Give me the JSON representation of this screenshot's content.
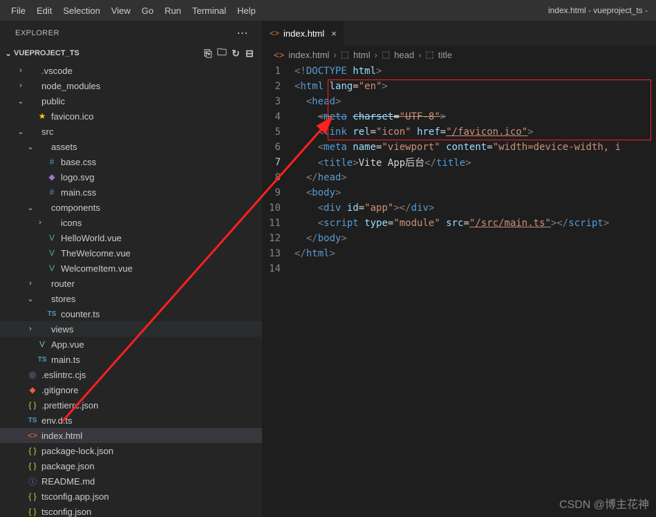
{
  "menu": {
    "items": [
      "File",
      "Edit",
      "Selection",
      "View",
      "Go",
      "Run",
      "Terminal",
      "Help"
    ],
    "title": "index.html - vueproject_ts -"
  },
  "explorer": {
    "title": "EXPLORER",
    "project": "VUEPROJECT_TS"
  },
  "tree": [
    {
      "ind": 1,
      "chev": "›",
      "ico": "",
      "lbl": ".vscode",
      "t": "d"
    },
    {
      "ind": 1,
      "chev": "›",
      "ico": "",
      "lbl": "node_modules",
      "t": "d"
    },
    {
      "ind": 1,
      "chev": "⌄",
      "ico": "",
      "lbl": "public",
      "t": "d"
    },
    {
      "ind": 2,
      "chev": "",
      "ico": "★",
      "cls": "star",
      "lbl": "favicon.ico",
      "t": "f"
    },
    {
      "ind": 1,
      "chev": "⌄",
      "ico": "",
      "lbl": "src",
      "t": "d"
    },
    {
      "ind": 2,
      "chev": "⌄",
      "ico": "",
      "lbl": "assets",
      "t": "d"
    },
    {
      "ind": 3,
      "chev": "",
      "ico": "#",
      "cls": "css",
      "lbl": "base.css",
      "t": "f"
    },
    {
      "ind": 3,
      "chev": "",
      "ico": "◆",
      "cls": "svg",
      "lbl": "logo.svg",
      "t": "f"
    },
    {
      "ind": 3,
      "chev": "",
      "ico": "#",
      "cls": "css",
      "lbl": "main.css",
      "t": "f"
    },
    {
      "ind": 2,
      "chev": "⌄",
      "ico": "",
      "lbl": "components",
      "t": "d"
    },
    {
      "ind": 3,
      "chev": "›",
      "ico": "",
      "lbl": "icons",
      "t": "d"
    },
    {
      "ind": 3,
      "chev": "",
      "ico": "V",
      "cls": "vue",
      "lbl": "HelloWorld.vue",
      "t": "f"
    },
    {
      "ind": 3,
      "chev": "",
      "ico": "V",
      "cls": "vue",
      "lbl": "TheWelcome.vue",
      "t": "f"
    },
    {
      "ind": 3,
      "chev": "",
      "ico": "V",
      "cls": "vue",
      "lbl": "WelcomeItem.vue",
      "t": "f"
    },
    {
      "ind": 2,
      "chev": "›",
      "ico": "",
      "lbl": "router",
      "t": "d"
    },
    {
      "ind": 2,
      "chev": "⌄",
      "ico": "",
      "lbl": "stores",
      "t": "d"
    },
    {
      "ind": 3,
      "chev": "",
      "ico": "TS",
      "cls": "ts",
      "lbl": "counter.ts",
      "t": "f"
    },
    {
      "ind": 2,
      "chev": "›",
      "ico": "",
      "lbl": "views",
      "t": "d",
      "sel": "views"
    },
    {
      "ind": 2,
      "chev": "",
      "ico": "V",
      "cls": "vue-s",
      "lbl": "App.vue",
      "t": "f"
    },
    {
      "ind": 2,
      "chev": "",
      "ico": "TS",
      "cls": "ts",
      "lbl": "main.ts",
      "t": "f"
    },
    {
      "ind": 1,
      "chev": "",
      "ico": "◎",
      "cls": "target",
      "lbl": ".eslintrc.cjs",
      "t": "f"
    },
    {
      "ind": 1,
      "chev": "",
      "ico": "◆",
      "cls": "git",
      "lbl": ".gitignore",
      "t": "f"
    },
    {
      "ind": 1,
      "chev": "",
      "ico": "{ }",
      "cls": "json",
      "lbl": ".prettierrc.json",
      "t": "f"
    },
    {
      "ind": 1,
      "chev": "",
      "ico": "TS",
      "cls": "ts",
      "lbl": "env.d.ts",
      "t": "f"
    },
    {
      "ind": 1,
      "chev": "",
      "ico": "<>",
      "cls": "html",
      "lbl": "index.html",
      "t": "f",
      "sel": "sel"
    },
    {
      "ind": 1,
      "chev": "",
      "ico": "{ }",
      "cls": "json",
      "lbl": "package-lock.json",
      "t": "f"
    },
    {
      "ind": 1,
      "chev": "",
      "ico": "{ }",
      "cls": "json",
      "lbl": "package.json",
      "t": "f"
    },
    {
      "ind": 1,
      "chev": "",
      "ico": "ⓘ",
      "cls": "info",
      "lbl": "README.md",
      "t": "f"
    },
    {
      "ind": 1,
      "chev": "",
      "ico": "{ }",
      "cls": "json",
      "lbl": "tsconfig.app.json",
      "t": "f"
    },
    {
      "ind": 1,
      "chev": "",
      "ico": "{ }",
      "cls": "json",
      "lbl": "tsconfig.json",
      "t": "f"
    }
  ],
  "tab": {
    "name": "index.html"
  },
  "crumbs": [
    "index.html",
    "html",
    "head",
    "title"
  ],
  "code": {
    "lines": [
      {
        "n": 1,
        "html": "<span class='c-pun'>&lt;!</span><span class='c-doc2'>DOCTYPE</span> <span class='c-attr'>html</span><span class='c-pun'>&gt;</span>"
      },
      {
        "n": 2,
        "html": "<span class='c-pun'>&lt;</span><span class='c-tag'>html</span> <span class='c-attr'>lang</span><span class='c-txt'>=</span><span class='c-str'>\"en\"</span><span class='c-pun'>&gt;</span>"
      },
      {
        "n": 3,
        "html": "  <span class='c-pun'>&lt;</span><span class='c-tag'>head</span><span class='c-pun'>&gt;</span>"
      },
      {
        "n": 4,
        "html": "    <span class='c-pun' style='text-decoration:line-through'>&lt;</span><span class='c-tag' style='text-decoration:line-through'>meta</span> <span class='c-attr' style='text-decoration:line-through'>charset</span><span class='c-txt' style='text-decoration:line-through'>=</span><span class='c-str' style='text-decoration:line-through'>\"UTF-8\"</span><span class='c-pun' style='text-decoration:line-through'>&gt;</span>"
      },
      {
        "n": 5,
        "html": "    <span class='c-pun'>&lt;</span><span class='c-tag'>link</span> <span class='c-attr'>rel</span><span class='c-txt'>=</span><span class='c-str'>\"icon\"</span> <span class='c-attr'>href</span><span class='c-txt'>=</span><span class='c-str' style='text-decoration:underline'>\"/favicon.ico\"</span><span class='c-pun'>&gt;</span>"
      },
      {
        "n": 6,
        "html": "    <span class='c-pun'>&lt;</span><span class='c-tag'>meta</span> <span class='c-attr'>name</span><span class='c-txt'>=</span><span class='c-str'>\"viewport\"</span> <span class='c-attr'>content</span><span class='c-txt'>=</span><span class='c-str'>\"width=device-width, i</span>"
      },
      {
        "n": 7,
        "html": "    <span class='c-pun'>&lt;</span><span class='c-tag'>title</span><span class='c-pun'>&gt;</span><span class='c-txt'>Vite App后台</span><span class='c-pun'>&lt;/</span><span class='c-tag'>title</span><span class='c-pun'>&gt;</span>",
        "cur": true
      },
      {
        "n": 8,
        "html": "  <span class='c-pun'>&lt;/</span><span class='c-tag'>head</span><span class='c-pun'>&gt;</span>"
      },
      {
        "n": 9,
        "html": "  <span class='c-pun'>&lt;</span><span class='c-tag'>body</span><span class='c-pun'>&gt;</span>"
      },
      {
        "n": 10,
        "html": "    <span class='c-pun'>&lt;</span><span class='c-tag'>div</span> <span class='c-attr'>id</span><span class='c-txt'>=</span><span class='c-str'>\"app\"</span><span class='c-pun'>&gt;&lt;/</span><span class='c-tag'>div</span><span class='c-pun'>&gt;</span>"
      },
      {
        "n": 11,
        "html": "    <span class='c-pun'>&lt;</span><span class='c-tag'>script</span> <span class='c-attr'>type</span><span class='c-txt'>=</span><span class='c-str'>\"module\"</span> <span class='c-attr'>src</span><span class='c-txt'>=</span><span class='c-str' style='text-decoration:underline'>\"/src/main.ts\"</span><span class='c-pun'>&gt;&lt;/</span><span class='c-tag'>script</span><span class='c-pun'>&gt;</span>"
      },
      {
        "n": 12,
        "html": "  <span class='c-pun'>&lt;/</span><span class='c-tag'>body</span><span class='c-pun'>&gt;</span>"
      },
      {
        "n": 13,
        "html": "<span class='c-pun'>&lt;/</span><span class='c-tag'>html</span><span class='c-pun'>&gt;</span>"
      },
      {
        "n": 14,
        "html": ""
      }
    ]
  },
  "watermark": "CSDN @博主花神"
}
